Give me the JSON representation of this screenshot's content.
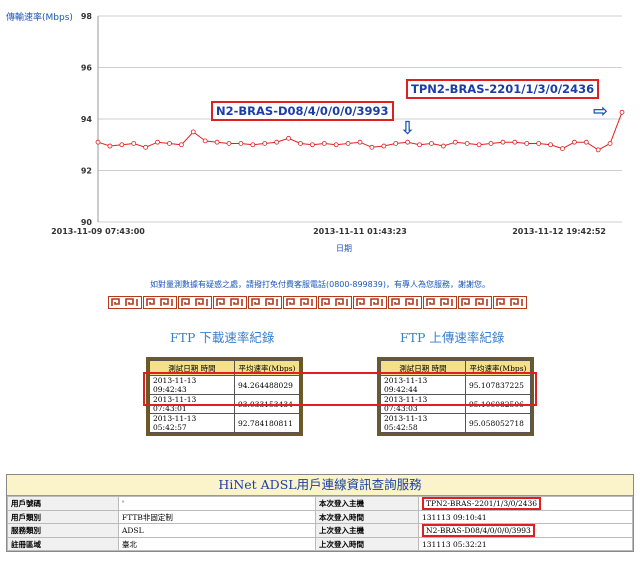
{
  "chart_data": {
    "type": "line",
    "ylabel": "傳輸速率(Mbps)",
    "xlabel": "日期",
    "ylim": [
      90,
      98
    ],
    "yticks": [
      "98",
      "96",
      "94",
      "92",
      "90"
    ],
    "xticks": [
      "2013-11-09 07:43:00",
      "2013-11-11 01:43:23",
      "2013-11-12 19:42:52"
    ],
    "series": [
      {
        "values": [
          93.1,
          92.95,
          93.0,
          93.05,
          92.9,
          93.1,
          93.05,
          93.0,
          93.5,
          93.15,
          93.1,
          93.05,
          93.05,
          93.0,
          93.05,
          93.1,
          93.25,
          93.05,
          93.0,
          93.05,
          93.0,
          93.05,
          93.1,
          92.9,
          92.95,
          93.05,
          93.1,
          93.0,
          93.05,
          92.95,
          93.1,
          93.05,
          93.0,
          93.05,
          93.1,
          93.1,
          93.05,
          93.05,
          93.0,
          92.85,
          93.1,
          93.1,
          92.8,
          93.05,
          94.26
        ]
      }
    ],
    "grid": true
  },
  "annotations": {
    "bras1": "TPN2-BRAS-2201/1/3/0/2436",
    "bras2": "N2-BRAS-D08/4/0/0/0/3993",
    "arrow_down": "⇩",
    "arrow_right": "⇨"
  },
  "notice": "如對量測數據有疑惑之處，請撥打免付費客服電話(0800-899839)，有專人為您服務，謝謝您。",
  "ftp_download": {
    "title": "FTP 下載速率紀錄",
    "headers": [
      "測試日期 時間",
      "平均速率(Mbps)"
    ],
    "rows": [
      [
        "2013-11-13 09:42:43",
        "94.264488029"
      ],
      [
        "2013-11-13 07:43:01",
        "93.033153434"
      ],
      [
        "2013-11-13 05:42:57",
        "92.784180811"
      ]
    ]
  },
  "ftp_upload": {
    "title": "FTP 上傳速率紀錄",
    "headers": [
      "測試日期 時間",
      "平均速率(Mbps)"
    ],
    "rows": [
      [
        "2013-11-13 09:42:44",
        "95.107837225"
      ],
      [
        "2013-11-13 07:43:03",
        "95.106082506"
      ],
      [
        "2013-11-13 05:42:58",
        "95.058052718"
      ]
    ]
  },
  "hinet": {
    "title": "HiNet ADSL用戶連線資訊查詢服務",
    "rows": [
      {
        "k1": "用戶號碼",
        "v1": "'",
        "k2": "本次登入主機",
        "v2": "TPN2-BRAS-2201/1/3/0/2436"
      },
      {
        "k1": "用戶類別",
        "v1": "FTTB非固定制",
        "k2": "本次登入時間",
        "v2": "131113 09:10:41"
      },
      {
        "k1": "服務類別",
        "v1": "ADSL",
        "k2": "上次登入主機",
        "v2": "N2-BRAS-D08/4/0/0/0/3993"
      },
      {
        "k1": "註冊區域",
        "v1": "臺北",
        "k2": "上次登入時間",
        "v2": "131113 05:32:21"
      }
    ]
  },
  "colors": {
    "line": "#e02020",
    "accent": "#1a56b8",
    "header_bg": "#f2e08a",
    "border_red": "#e02020"
  }
}
